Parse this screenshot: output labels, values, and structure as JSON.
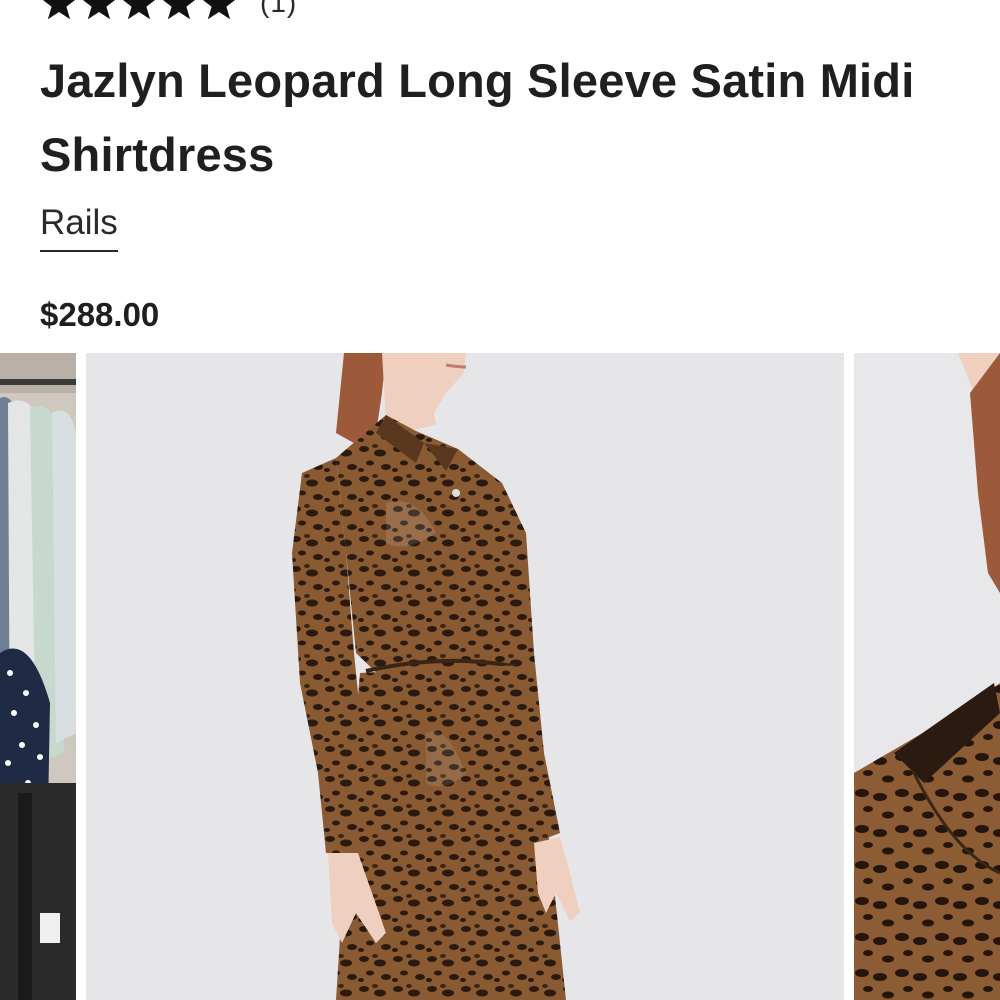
{
  "product": {
    "rating": {
      "stars": 5,
      "review_count": "(1)"
    },
    "title": "Jazlyn Leopard Long Sleeve Satin Midi Shirtdress",
    "brand": "Rails",
    "price": "$288.00"
  },
  "gallery": {
    "images": [
      {
        "name": "clothing-rack-thumbnail",
        "icon": "product-photo"
      },
      {
        "name": "leopard-shirtdress-main-photo",
        "icon": "product-photo"
      },
      {
        "name": "leopard-shirtdress-collar-detail",
        "icon": "product-photo"
      }
    ]
  },
  "colors": {
    "text": "#1f1f1f",
    "background": "#ffffff",
    "dress_brown": "#8a5a33",
    "dress_spots": "#2a1a10"
  }
}
